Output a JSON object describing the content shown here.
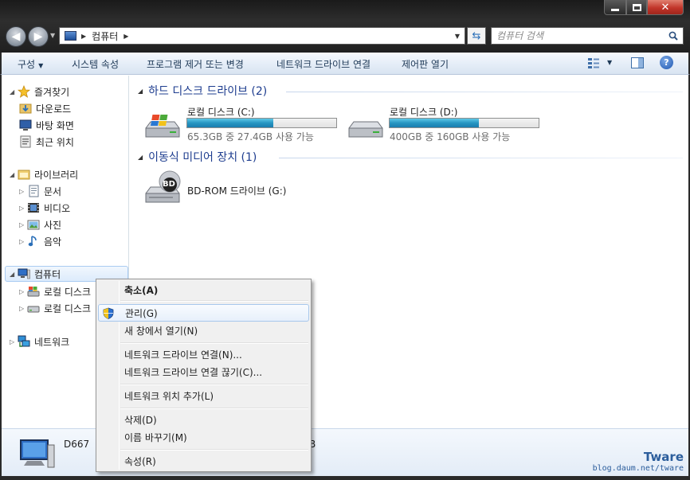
{
  "window": {
    "address_location": "컴퓨터",
    "search_placeholder": "컴퓨터 검색"
  },
  "toolbar": {
    "organize": "구성",
    "system_properties": "시스템 속성",
    "uninstall_program": "프로그램 제거 또는 변경",
    "map_network_drive": "네트워크 드라이브 연결",
    "control_panel": "제어판 열기"
  },
  "navpane": {
    "favorites": "즐겨찾기",
    "downloads": "다운로드",
    "desktop": "바탕 화면",
    "recent": "최근 위치",
    "libraries": "라이브러리",
    "documents": "문서",
    "videos": "비디오",
    "pictures": "사진",
    "music": "음악",
    "computer": "컴퓨터",
    "local_c": "로컬 디스크",
    "local_d": "로컬 디스크",
    "network": "네트워크"
  },
  "content": {
    "hdd_group": "하드 디스크 드라이브 (2)",
    "removable_group": "이동식 미디어 장치 (1)",
    "drives": [
      {
        "name": "로컬 디스크 (C:)",
        "free_text": "65.3GB 중 27.4GB 사용 가능",
        "used_fraction": 0.58
      },
      {
        "name": "로컬 디스크 (D:)",
        "free_text": "400GB 중 160GB 사용 가능",
        "used_fraction": 0.6
      }
    ],
    "bd_label": "BD",
    "bdrom": "BD-ROM 드라이브 (G:)"
  },
  "details": {
    "name": "D667",
    "extra": "B"
  },
  "watermark": {
    "title": "Tware",
    "url": "blog.daum.net/tware"
  },
  "context_menu": {
    "collapse": "축소(A)",
    "manage": "관리(G)",
    "open_new_window": "새 창에서 열기(N)",
    "map_drive": "네트워크 드라이브 연결(N)...",
    "disconnect_drive": "네트워크 드라이브 연결 끊기(C)...",
    "add_network_location": "네트워크 위치 추가(L)",
    "delete": "삭제(D)",
    "rename": "이름 바꾸기(M)",
    "properties": "속성(R)"
  },
  "colors": {
    "group_header": "#1e3d8f",
    "bar_fill": "#2795c2",
    "close_button": "#c2352a"
  }
}
